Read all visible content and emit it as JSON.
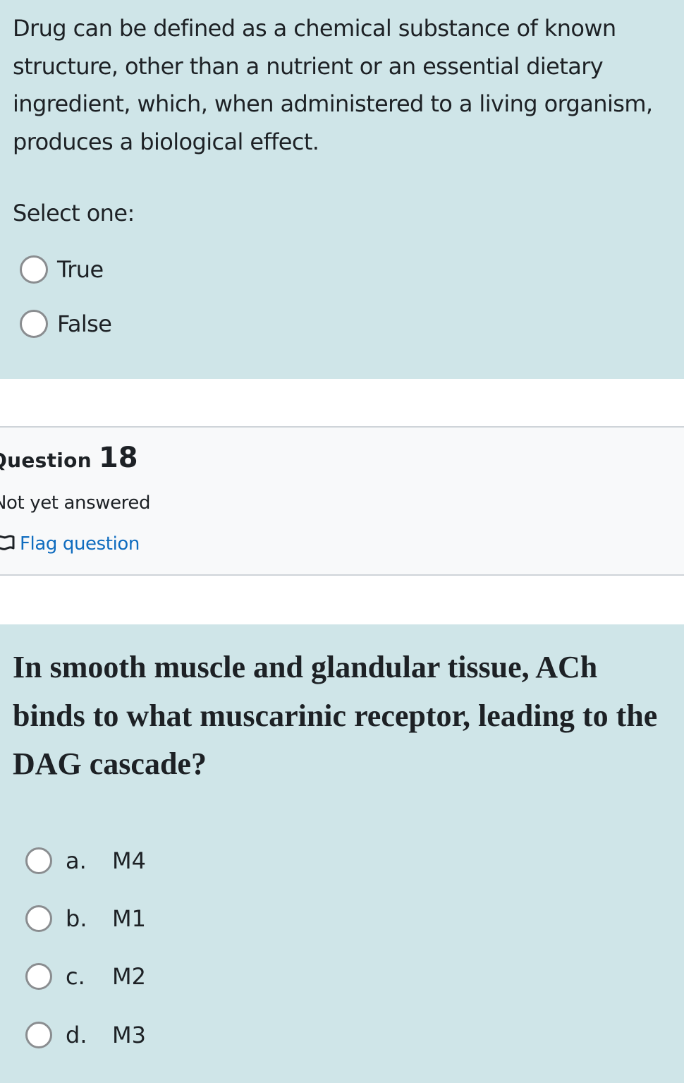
{
  "question17": {
    "text": "Drug can be defined as a chemical substance of known structure, other than a nutrient or an essential dietary ingredient, which, when administered to a living organism, produces a biological effect.",
    "prompt": "Select one:",
    "options": [
      {
        "label": "True"
      },
      {
        "label": "False"
      }
    ]
  },
  "question18": {
    "heading_word": "Question",
    "number": "18",
    "state": "Not yet answered",
    "flag_label": "Flag question",
    "text": "In smooth muscle and glandular tissue, ACh binds to what muscarinic receptor, leading to the DAG cascade?",
    "answers": [
      {
        "letter": "a.",
        "text": "M4"
      },
      {
        "letter": "b.",
        "text": "M1"
      },
      {
        "letter": "c.",
        "text": "M2"
      },
      {
        "letter": "d.",
        "text": "M3"
      }
    ]
  },
  "colors": {
    "question_background": "#cfe5e8",
    "info_background": "#f8f9fa",
    "link": "#0f6cbf",
    "text": "#1d2125"
  },
  "icons": {
    "flag": "flag-outline-icon",
    "radio": "radio-unchecked-icon"
  }
}
